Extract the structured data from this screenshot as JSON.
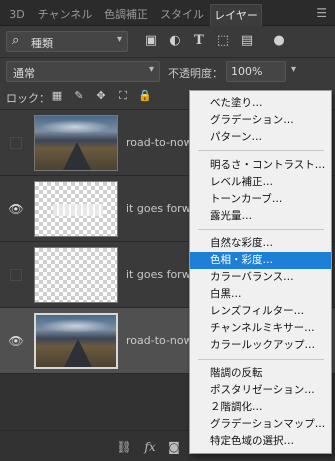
{
  "tabs": [
    "3D",
    "チャンネル",
    "色調補正",
    "スタイル",
    "レイヤー"
  ],
  "active_tab": "レイヤー",
  "filter": {
    "label": "種類"
  },
  "blend": {
    "mode": "通常",
    "opacity_label": "不透明度：",
    "opacity_value": "100%"
  },
  "lock": {
    "label": "ロック："
  },
  "layers": [
    {
      "name": "road-to-nowhere",
      "visible": false
    },
    {
      "name": "it goes forward",
      "visible": true
    },
    {
      "name": "it goes forward",
      "visible": false
    },
    {
      "name": "road-to-nowhere",
      "visible": true
    }
  ],
  "bottom": {
    "fx": "fx"
  },
  "menu": {
    "groups": [
      [
        "べた塗り…",
        "グラデーション…",
        "パターン…"
      ],
      [
        "明るさ・コントラスト…",
        "レベル補正…",
        "トーンカーブ…",
        "露光量…"
      ],
      [
        "自然な彩度…",
        "色相・彩度…",
        "カラーバランス…",
        "白黒…",
        "レンズフィルター…",
        "チャンネルミキサー…",
        "カラールックアップ…"
      ],
      [
        "階調の反転",
        "ポスタリゼーション…",
        "２階調化…",
        "グラデーションマップ…",
        "特定色域の選択…"
      ]
    ],
    "highlighted": "色相・彩度…",
    "highlight_color": "#1e7fd6"
  }
}
